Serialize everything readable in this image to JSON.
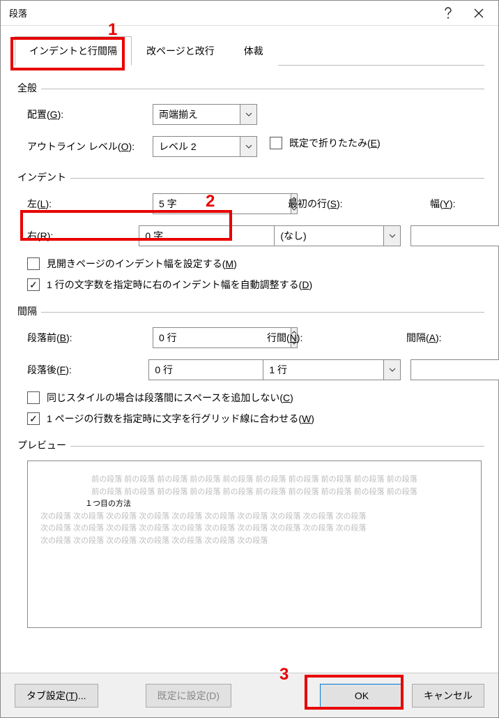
{
  "window": {
    "title": "段落"
  },
  "tabs": {
    "t1": "インデントと行間隔",
    "t2": "改ページと改行",
    "t3": "体裁"
  },
  "general": {
    "heading": "全般",
    "alignment_label_pre": "配置(",
    "alignment_key": "G",
    "alignment_label_post": "):",
    "alignment_value": "両端揃え",
    "outline_label_pre": "アウトライン レベル(",
    "outline_key": "O",
    "outline_label_post": "):",
    "outline_value": "レベル 2",
    "collapse_label_pre": "既定で折りたたみ(",
    "collapse_key": "E",
    "collapse_label_post": ")"
  },
  "indent": {
    "heading": "インデント",
    "left_label_pre": "左(",
    "left_key": "L",
    "left_label_post": "):",
    "left_value": "5 字",
    "right_label_pre": "右(",
    "right_key": "R",
    "right_label_post": "):",
    "right_value": "0 字",
    "firstline_label_pre": "最初の行(",
    "firstline_key": "S",
    "firstline_label_post": "):",
    "firstline_value": "(なし)",
    "by_label_pre": "幅(",
    "by_key": "Y",
    "by_label_post": "):",
    "by_value": "",
    "mirror_label_pre": "見開きページのインデント幅を設定する(",
    "mirror_key": "M",
    "mirror_label_post": ")",
    "autoadjust_label_pre": "1 行の文字数を指定時に右のインデント幅を自動調整する(",
    "autoadjust_key": "D",
    "autoadjust_label_post": ")"
  },
  "spacing": {
    "heading": "間隔",
    "before_label_pre": "段落前(",
    "before_key": "B",
    "before_label_post": "):",
    "before_value": "0 行",
    "after_label_pre": "段落後(",
    "after_key": "F",
    "after_label_post": "):",
    "after_value": "0 行",
    "linesp_label_pre": "行間(",
    "linesp_key": "N",
    "linesp_label_post": "):",
    "linesp_value": "1 行",
    "at_label_pre": "間隔(",
    "at_key": "A",
    "at_label_post": "):",
    "at_value": "",
    "nospace_label_pre": "同じスタイルの場合は段落間にスペースを追加しない(",
    "nospace_key": "C",
    "nospace_label_post": ")",
    "snap_label_pre": "1 ページの行数を指定時に文字を行グリッド線に合わせる(",
    "snap_key": "W",
    "snap_label_post": ")"
  },
  "preview": {
    "heading": "プレビュー",
    "ghost_prev": "前の段落  前の段落  前の段落  前の段落  前の段落  前の段落  前の段落  前の段落  前の段落  前の段落",
    "ghost_prev2": "前の段落  前の段落  前の段落  前の段落  前の段落  前の段落  前の段落  前の段落  前の段落  前の段落",
    "primary": "１つ目の方法",
    "ghost_next": "次の段落  次の段落  次の段落  次の段落  次の段落  次の段落  次の段落  次の段落  次の段落  次の段落",
    "ghost_next2": "次の段落  次の段落  次の段落  次の段落  次の段落  次の段落  次の段落  次の段落  次の段落  次の段落",
    "ghost_next3": "次の段落  次の段落  次の段落  次の段落  次の段落  次の段落  次の段落"
  },
  "footer": {
    "tabs_btn_pre": "タブ設定(",
    "tabs_btn_key": "T",
    "tabs_btn_post": ")...",
    "default_btn_pre": "既定に設定(",
    "default_btn_key": "D",
    "default_btn_post": ")",
    "ok": "OK",
    "cancel": "キャンセル"
  },
  "annotations": {
    "n1": "1",
    "n2": "2",
    "n3": "3"
  }
}
